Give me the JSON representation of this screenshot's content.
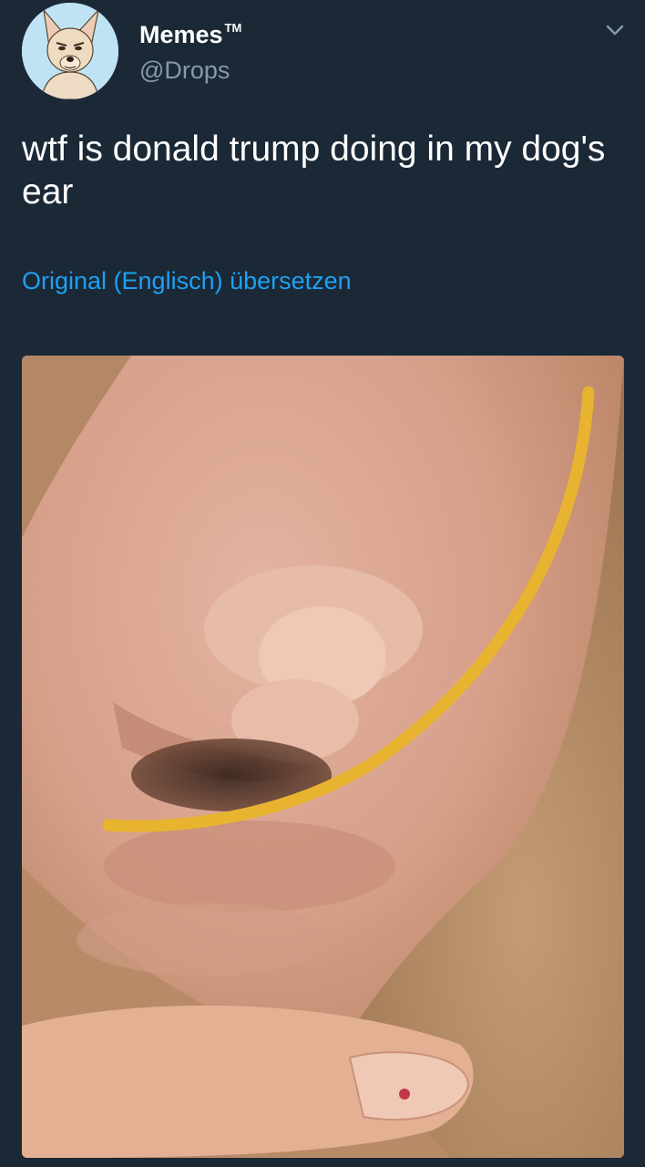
{
  "account": {
    "display_name": "Memes",
    "trademark": "TM",
    "handle": "@Drops",
    "avatar_icon": "dog-avatar-icon"
  },
  "menu": {
    "icon": "chevron-down-icon"
  },
  "tweet": {
    "text": "wtf is donald trump doing in my dog's ear",
    "translate_label": "Original (Englisch) übersetzen"
  },
  "media": {
    "type": "photo",
    "subject": "dog-ear-photo"
  },
  "colors": {
    "background": "#1b2836",
    "primary_text": "#ffffff",
    "secondary_text": "#8899a6",
    "link": "#1da1f2",
    "highlight_line": "#e8b430"
  }
}
